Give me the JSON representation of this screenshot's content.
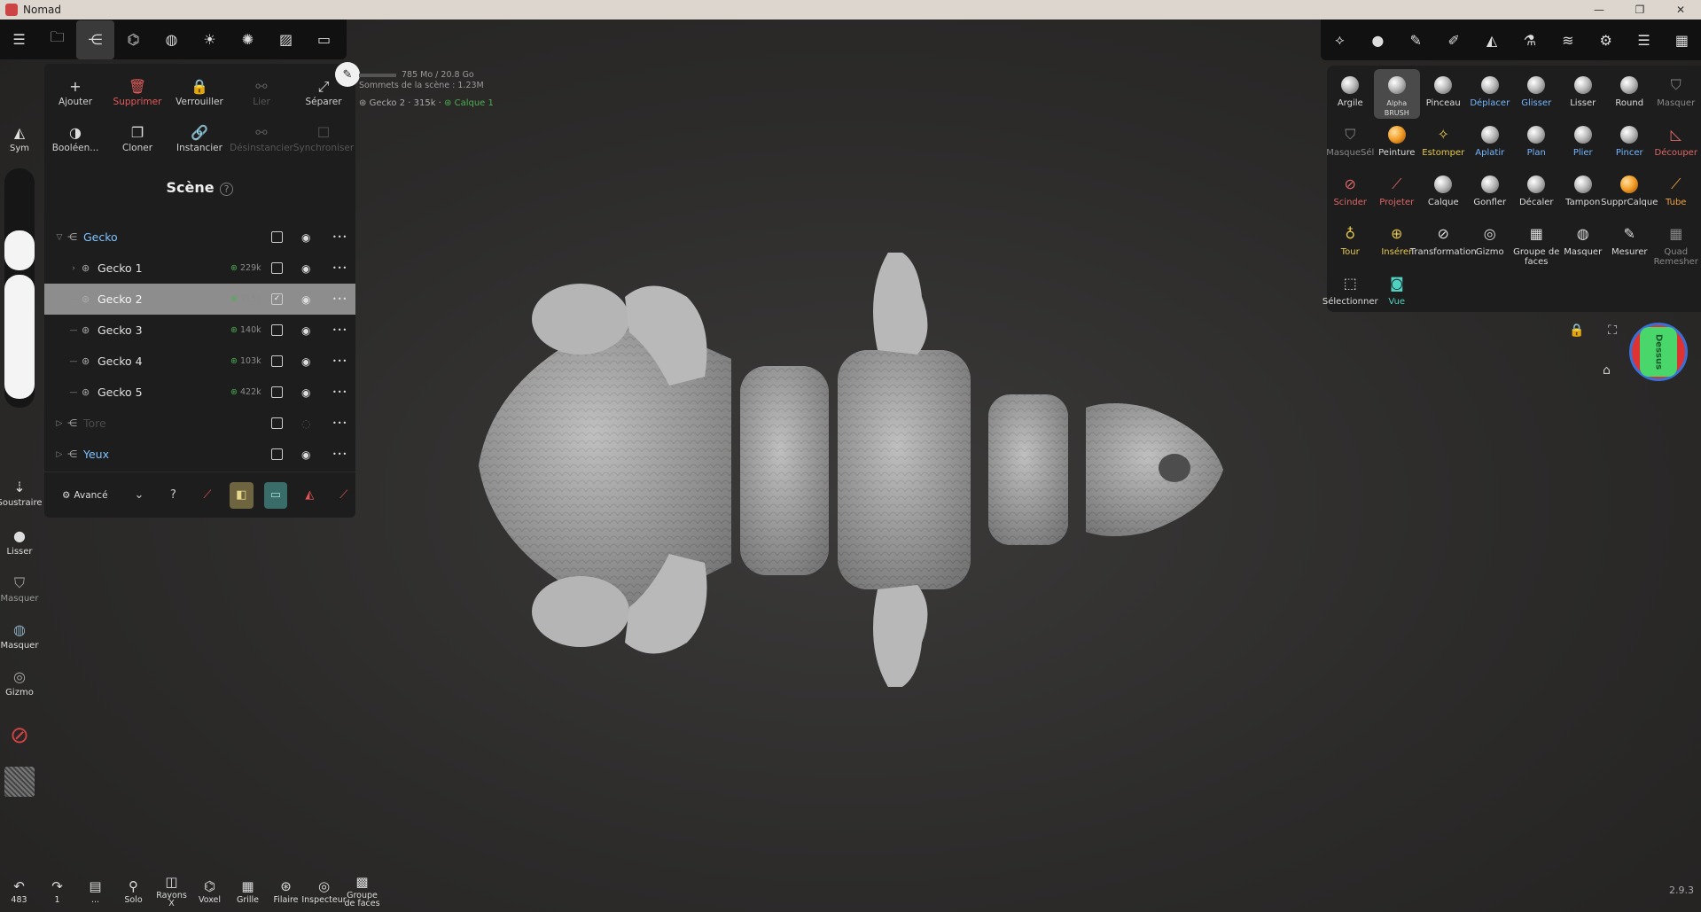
{
  "window": {
    "title": "Nomad",
    "minimize": "—",
    "maximize": "❐",
    "close": "✕"
  },
  "topbar_left": [
    {
      "name": "menu-icon",
      "glyph": "☰"
    },
    {
      "name": "folder-icon",
      "glyph": "🗀"
    },
    {
      "name": "scene-icon",
      "glyph": "⋲"
    },
    {
      "name": "topology-icon",
      "glyph": "⌬"
    },
    {
      "name": "material-icon",
      "glyph": "◍"
    },
    {
      "name": "light-icon",
      "glyph": "☀"
    },
    {
      "name": "postprocess-icon",
      "glyph": "✺"
    },
    {
      "name": "image-icon",
      "glyph": "▨"
    },
    {
      "name": "camera-icon",
      "glyph": "▭"
    }
  ],
  "topbar_right": [
    {
      "name": "interface-icon",
      "glyph": "⟡"
    },
    {
      "name": "material-ball-icon",
      "glyph": "●"
    },
    {
      "name": "stroke-icon",
      "glyph": "✎"
    },
    {
      "name": "painting-icon",
      "glyph": "✐"
    },
    {
      "name": "symmetry-icon",
      "glyph": "◭"
    },
    {
      "name": "flask-icon",
      "glyph": "⚗"
    },
    {
      "name": "layers-icon",
      "glyph": "≋"
    },
    {
      "name": "settings-icon",
      "glyph": "⚙"
    },
    {
      "name": "sliders-icon",
      "glyph": "☰"
    },
    {
      "name": "gift-icon",
      "glyph": "▦"
    }
  ],
  "scene_actions": [
    {
      "label": "Ajouter",
      "glyph": "+",
      "style": ""
    },
    {
      "label": "Supprimer",
      "glyph": "🗑",
      "style": "red"
    },
    {
      "label": "Verrouiller",
      "glyph": "🔒",
      "style": ""
    },
    {
      "label": "Lier",
      "glyph": "⚯",
      "style": "disabled"
    },
    {
      "label": "Séparer",
      "glyph": "⤢",
      "style": ""
    },
    {
      "label": "Booléen...",
      "glyph": "◑",
      "style": ""
    },
    {
      "label": "Cloner",
      "glyph": "❐",
      "style": ""
    },
    {
      "label": "Instancier",
      "glyph": "🔗",
      "style": ""
    },
    {
      "label": "Désinstancier",
      "glyph": "⚯",
      "style": "disabled"
    },
    {
      "label": "Synchroniser",
      "glyph": "☐",
      "style": "disabled"
    }
  ],
  "scene": {
    "title": "Scène",
    "help": "?",
    "memory": "785 Mo / 20.8 Go",
    "vertices": "Sommets de la scène : 1.23M",
    "selection_object": "Gecko 2 · 315k ·",
    "selection_layer": "Calque 1"
  },
  "tree": [
    {
      "name": "Gecko",
      "indent": 0,
      "arrow": "▽",
      "icon": "⋲",
      "count": "",
      "checked": false,
      "visible": true,
      "selected": false,
      "style": "blue"
    },
    {
      "name": "Gecko 1",
      "indent": 1,
      "arrow": "›",
      "icon": "⊛",
      "count": "229k",
      "checked": false,
      "visible": true,
      "selected": false,
      "style": ""
    },
    {
      "name": "Gecko 2",
      "indent": 1,
      "arrow": "—",
      "icon": "⊛",
      "count": "315k",
      "checked": true,
      "visible": true,
      "selected": true,
      "style": ""
    },
    {
      "name": "Gecko 3",
      "indent": 1,
      "arrow": "—",
      "icon": "⊛",
      "count": "140k",
      "checked": false,
      "visible": true,
      "selected": false,
      "style": ""
    },
    {
      "name": "Gecko 4",
      "indent": 1,
      "arrow": "—",
      "icon": "⊛",
      "count": "103k",
      "checked": false,
      "visible": true,
      "selected": false,
      "style": ""
    },
    {
      "name": "Gecko 5",
      "indent": 1,
      "arrow": "—",
      "icon": "⊛",
      "count": "422k",
      "checked": false,
      "visible": true,
      "selected": false,
      "style": ""
    },
    {
      "name": "Tore",
      "indent": 0,
      "arrow": "▷",
      "icon": "⋲",
      "count": "",
      "checked": false,
      "visible": false,
      "selected": false,
      "style": "dim"
    },
    {
      "name": "Yeux",
      "indent": 0,
      "arrow": "▷",
      "icon": "⋲",
      "count": "",
      "checked": false,
      "visible": true,
      "selected": false,
      "style": "blue"
    }
  ],
  "panel_footer": {
    "advanced": "Avancé"
  },
  "left_sidebar": {
    "sym": "Sym",
    "subtract": "Soustraire",
    "smooth": "Lisser",
    "mask": "Masquer",
    "mask2": "Masquer",
    "gizmo": "Gizmo",
    "radius_fill": 0.55,
    "intensity_fill": 1.0
  },
  "bottom_bar": [
    {
      "label": "483",
      "glyph": "↶",
      "name": "undo-button"
    },
    {
      "label": "1",
      "glyph": "↷",
      "name": "redo-button"
    },
    {
      "label": "...",
      "glyph": "▤",
      "name": "history-button"
    },
    {
      "label": "Solo",
      "glyph": "⚲",
      "name": "solo-button"
    },
    {
      "label": "Rayons X",
      "glyph": "◫",
      "name": "xray-button"
    },
    {
      "label": "Voxel",
      "glyph": "⌬",
      "name": "voxel-button"
    },
    {
      "label": "Grille",
      "glyph": "▦",
      "name": "grid-button"
    },
    {
      "label": "Filaire",
      "glyph": "⊛",
      "name": "wireframe-button"
    },
    {
      "label": "Inspecteur",
      "glyph": "◎",
      "name": "inspector-button"
    },
    {
      "label": "Groupe de faces",
      "glyph": "▩",
      "name": "facegroup-button"
    }
  ],
  "version": "2.9.3",
  "brushes": [
    {
      "label": "Argile",
      "kind": "ball",
      "style": ""
    },
    {
      "label": "Alpha BRUSH",
      "kind": "ball",
      "style": "",
      "active": true
    },
    {
      "label": "Pinceau",
      "kind": "ball",
      "style": ""
    },
    {
      "label": "Déplacer",
      "kind": "ball",
      "style": "blue"
    },
    {
      "label": "Glisser",
      "kind": "ball",
      "style": "blue"
    },
    {
      "label": "Lisser",
      "kind": "ball",
      "style": ""
    },
    {
      "label": "Round",
      "kind": "ball",
      "style": ""
    },
    {
      "label": "Masquer",
      "kind": "glyph",
      "glyph": "⛉",
      "style": "muted"
    },
    {
      "label": "MasqueSél",
      "kind": "glyph",
      "glyph": "⛉",
      "style": "muted"
    },
    {
      "label": "Peinture",
      "kind": "orange-ball",
      "style": ""
    },
    {
      "label": "Estomper",
      "kind": "glyph",
      "glyph": "✧",
      "style": "yellow"
    },
    {
      "label": "Aplatir",
      "kind": "ball",
      "style": "blue"
    },
    {
      "label": "Plan",
      "kind": "ball",
      "style": "blue"
    },
    {
      "label": "Plier",
      "kind": "ball",
      "style": "blue"
    },
    {
      "label": "Pincer",
      "kind": "ball",
      "style": "blue"
    },
    {
      "label": "Découper",
      "kind": "glyph",
      "glyph": "◺",
      "style": "red"
    },
    {
      "label": "Scinder",
      "kind": "glyph",
      "glyph": "⊘",
      "style": "red"
    },
    {
      "label": "Projeter",
      "kind": "glyph",
      "glyph": "⟋",
      "style": "red"
    },
    {
      "label": "Calque",
      "kind": "ball",
      "style": ""
    },
    {
      "label": "Gonfler",
      "kind": "ball",
      "style": ""
    },
    {
      "label": "Décaler",
      "kind": "ball",
      "style": ""
    },
    {
      "label": "Tampon",
      "kind": "ball",
      "style": ""
    },
    {
      "label": "SupprCalque",
      "kind": "orange-ball",
      "style": ""
    },
    {
      "label": "Tube",
      "kind": "glyph",
      "glyph": "⟋",
      "style": "orange"
    },
    {
      "label": "Tour",
      "kind": "glyph",
      "glyph": "♁",
      "style": "yellow"
    },
    {
      "label": "Insérer",
      "kind": "glyph",
      "glyph": "⊕",
      "style": "yellow"
    },
    {
      "label": "Transformation",
      "kind": "glyph",
      "glyph": "⊘",
      "style": ""
    },
    {
      "label": "Gizmo",
      "kind": "glyph",
      "glyph": "◎",
      "style": ""
    },
    {
      "label": "Groupe de faces",
      "kind": "glyph",
      "glyph": "▦",
      "style": ""
    },
    {
      "label": "Masquer",
      "kind": "glyph",
      "glyph": "◍",
      "style": ""
    },
    {
      "label": "Mesurer",
      "kind": "glyph",
      "glyph": "✎",
      "style": ""
    },
    {
      "label": "Quad Remesher",
      "kind": "glyph",
      "glyph": "▦",
      "style": "muted"
    },
    {
      "label": "Sélectionner",
      "kind": "glyph",
      "glyph": "⬚",
      "style": ""
    },
    {
      "label": "Vue",
      "kind": "glyph",
      "glyph": "◙",
      "style": "teal"
    }
  ],
  "viewcube": {
    "face": "Dessus"
  }
}
